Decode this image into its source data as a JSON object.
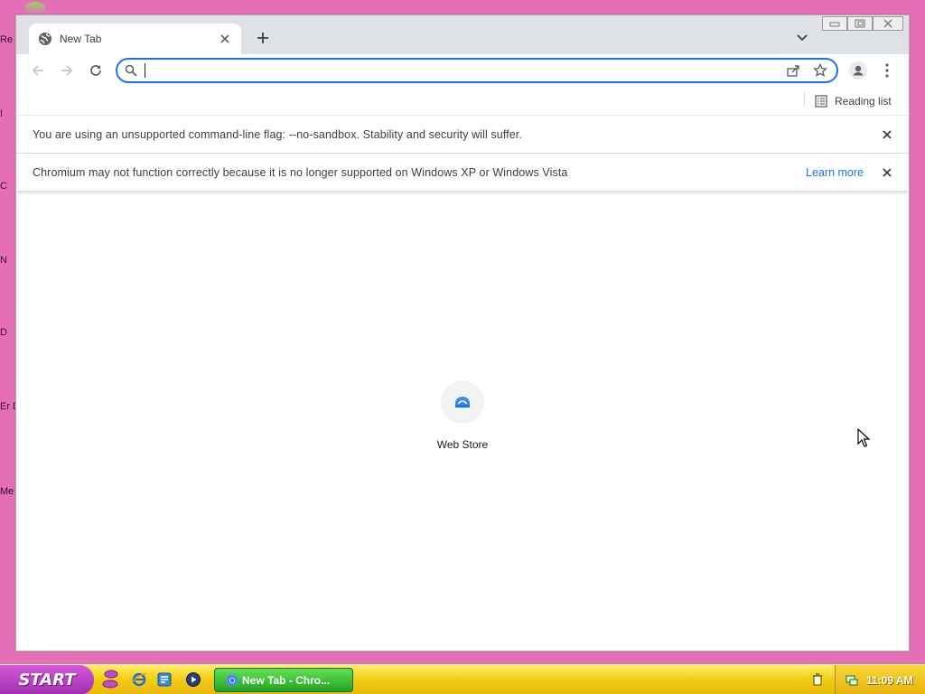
{
  "desktop": {
    "background_color": "#e46fb7",
    "label_fragments": [
      "Re",
      "I",
      "C",
      "N",
      "D",
      "Er D",
      "Me"
    ]
  },
  "browser": {
    "tab": {
      "title": "New Tab",
      "favicon": "globe-icon"
    },
    "toolbar": {
      "omnibox_value": "",
      "omnibox_placeholder": "",
      "focus_color": "#1a73e8"
    },
    "bookmarks_bar": {
      "reading_list_label": "Reading list"
    },
    "infobars": [
      {
        "message": "You are using an unsupported command-line flag: --no-sandbox. Stability and security will suffer."
      },
      {
        "message": "Chromium may not function correctly because it is no longer supported on Windows XP or Windows Vista",
        "link": "Learn more"
      }
    ],
    "shortcuts": [
      {
        "title": "Web Store"
      }
    ]
  },
  "taskbar": {
    "start_label": "START",
    "task_button_label": "New Tab - Chro...",
    "clock": "11:09 AM"
  }
}
